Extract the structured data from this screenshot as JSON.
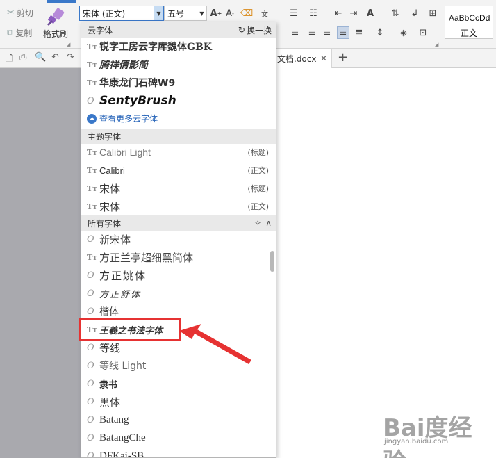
{
  "ribbon": {
    "cut_label": "剪切",
    "copy_label": "复制",
    "format_painter_label": "格式刷",
    "font_name": "宋体 (正文)",
    "font_size": "五号",
    "style_sample": "AaBbCcDd",
    "style_name": "正文"
  },
  "tabs": {
    "doc_tab_label": "文档.docx",
    "new_tab": "+"
  },
  "dropdown": {
    "cloud_header": "云字体",
    "refresh_label": "换一换",
    "cloud_fonts": [
      "锐字工房云字库魏体GBK",
      "腾祥倩影简",
      "华康龙门石碑W9",
      "SentyBrush"
    ],
    "more_cloud": "查看更多云字体",
    "theme_header": "主题字体",
    "theme_fonts": [
      {
        "name": "Calibri Light",
        "tag": "(标题)"
      },
      {
        "name": "Calibri",
        "tag": "(正文)"
      },
      {
        "name": "宋体",
        "tag": "(标题)"
      },
      {
        "name": "宋体",
        "tag": "(正文)"
      }
    ],
    "all_header": "所有字体",
    "all_fonts": [
      "新宋体",
      "方正兰亭超细黑简体",
      "方正姚体",
      "方正舒体",
      "楷体",
      "王羲之书法字体",
      "等线",
      "等线 Light",
      "隶书",
      "黑体",
      "Batang",
      "BatangChe",
      "DFKai-SB"
    ]
  },
  "watermark": {
    "logo": "Bai度经验",
    "url": "jingyan.baidu.com"
  },
  "colors": {
    "accent": "#3a78c9",
    "highlight": "#e63232",
    "link": "#2563b8"
  }
}
